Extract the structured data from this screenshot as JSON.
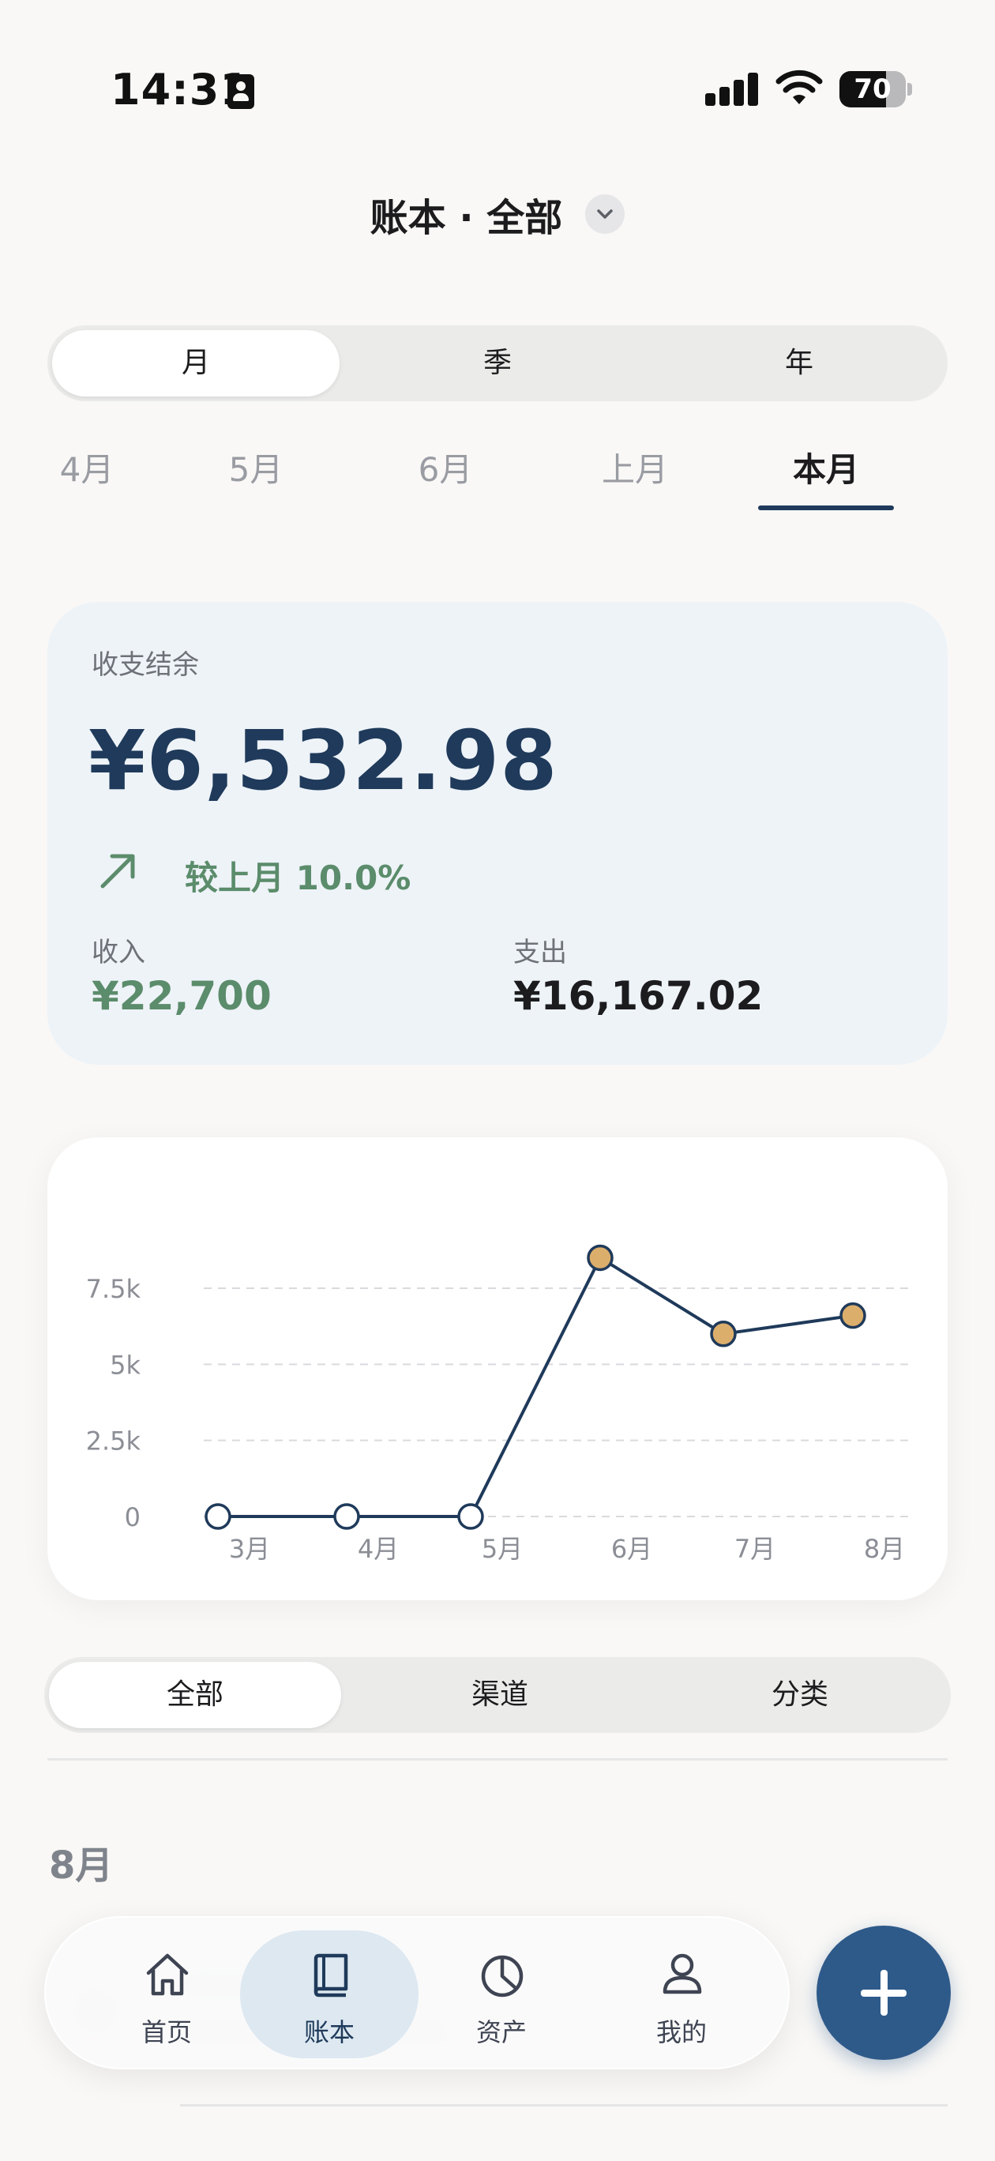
{
  "status_bar": {
    "time": "14:31",
    "battery": "70",
    "battery_level": 0.7
  },
  "header": {
    "title": "账本 · 全部"
  },
  "period_segment": {
    "items": [
      "月",
      "季",
      "年"
    ],
    "active": 0
  },
  "month_tabs": {
    "items": [
      "4月",
      "5月",
      "6月",
      "上月",
      "本月"
    ],
    "active": 4
  },
  "balance_card": {
    "label": "收支结余",
    "amount": "¥6,532.98",
    "trend_text": "较上月 10.0%",
    "income_label": "收入",
    "income_value": "¥22,700",
    "expense_label": "支出",
    "expense_value": "¥16,167.02"
  },
  "chart_data": {
    "type": "line",
    "categories": [
      "3月",
      "4月",
      "5月",
      "6月",
      "7月",
      "8月"
    ],
    "values": [
      0,
      0,
      0,
      8500,
      6000,
      6600
    ],
    "yticks": [
      "0",
      "2.5k",
      "5k",
      "7.5k"
    ],
    "ytick_values": [
      0,
      2500,
      5000,
      7500
    ],
    "ylim": [
      0,
      9000
    ],
    "grid": true,
    "colors": {
      "line": "#1f3a5a",
      "point_fill": "#dcae6c",
      "point_empty": "#ffffff"
    }
  },
  "filter_segment": {
    "items": [
      "全部",
      "渠道",
      "分类"
    ],
    "active": 0
  },
  "section": {
    "month": "8月"
  },
  "bottom_nav": {
    "items": [
      {
        "label": "首页",
        "icon": "home-icon"
      },
      {
        "label": "账本",
        "icon": "book-icon"
      },
      {
        "label": "资产",
        "icon": "pie-chart-icon"
      },
      {
        "label": "我的",
        "icon": "user-icon"
      }
    ],
    "active": 1
  },
  "fab": {
    "icon": "plus-icon"
  },
  "colors": {
    "accent": "#1f3a5a",
    "positive": "#5b8c6b",
    "fab": "#2e5a8a"
  }
}
